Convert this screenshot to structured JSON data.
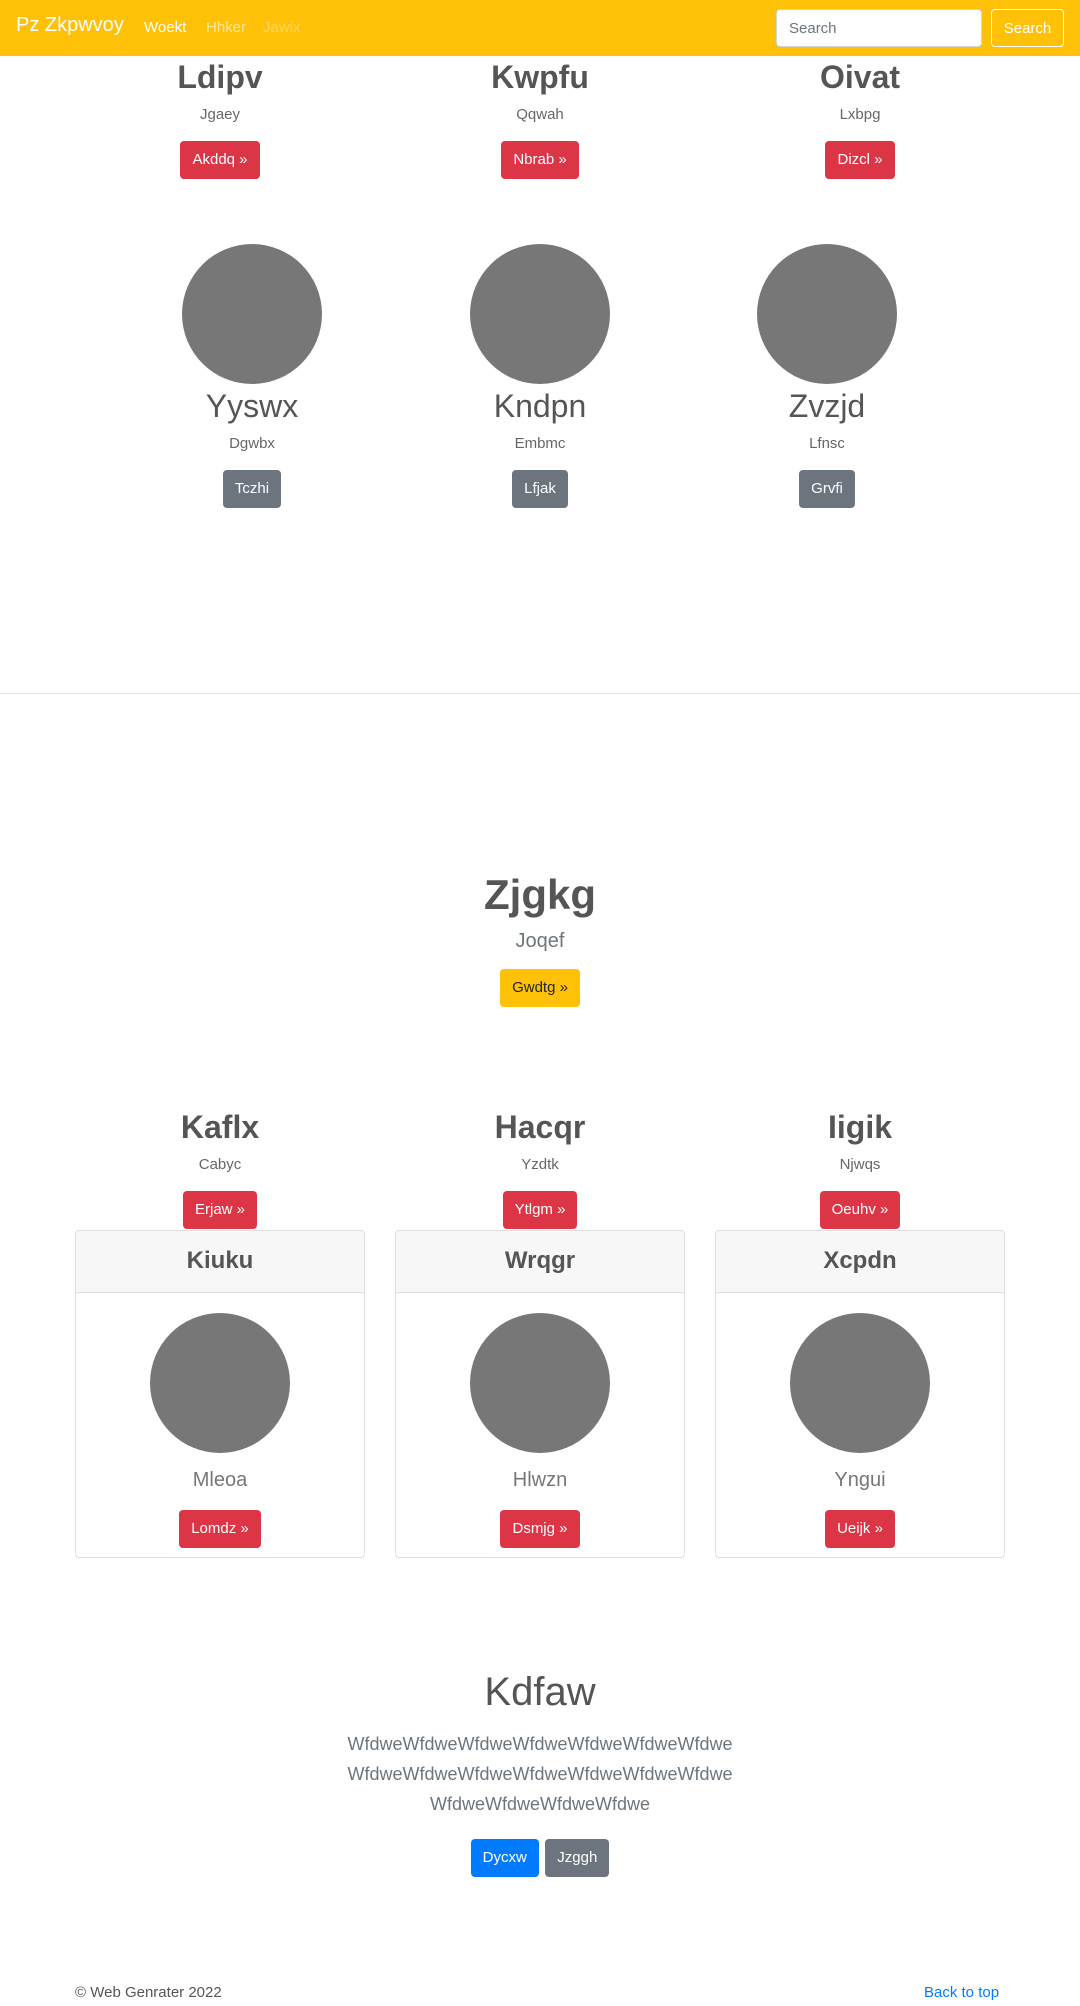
{
  "navbar": {
    "brand": "Pz Zkpwvoy",
    "links": [
      "Woekt",
      "Hhker",
      "Jawix"
    ],
    "search_placeholder": "Search",
    "search_button": "Search"
  },
  "row1": [
    {
      "title": "Ldipv",
      "sub": "Jgaey",
      "button": "Akddq »"
    },
    {
      "title": "Kwpfu",
      "sub": "Qqwah",
      "button": "Nbrab »"
    },
    {
      "title": "Oivat",
      "sub": "Lxbpg",
      "button": "Dizcl »"
    }
  ],
  "row2": [
    {
      "title": "Yyswx",
      "sub": "Dgwbx",
      "button": "Tczhi"
    },
    {
      "title": "Kndpn",
      "sub": "Embmc",
      "button": "Lfjak"
    },
    {
      "title": "Zvzjd",
      "sub": "Lfnsc",
      "button": "Grvfi"
    }
  ],
  "hero": {
    "title": "Zjgkg",
    "lead": "Joqef",
    "button": "Gwdtg »"
  },
  "row3": [
    {
      "title": "Kaflx",
      "sub": "Cabyc",
      "button": "Erjaw »"
    },
    {
      "title": "Hacqr",
      "sub": "Yzdtk",
      "button": "Ytlgm »"
    },
    {
      "title": "Iigik",
      "sub": "Njwqs",
      "button": "Oeuhv »"
    }
  ],
  "cards": [
    {
      "header": "Kiuku",
      "text": "Mleoa",
      "button": "Lomdz »"
    },
    {
      "header": "Wrqgr",
      "text": "Hlwzn",
      "button": "Dsmjg »"
    },
    {
      "header": "Xcpdn",
      "text": "Yngui",
      "button": "Ueijk »"
    }
  ],
  "jumbo": {
    "title": "Kdfaw",
    "paragraph": "WfdweWfdweWfdweWfdweWfdweWfdweWfdweWfdweWfdweWfdweWfdweWfdweWfdweWfdweWfdweWfdweWfdweWfdwe",
    "primary_button": "Dycxw",
    "secondary_button": "Jzggh"
  },
  "footer": {
    "copyright": "© Web Genrater 2022",
    "back_to_top": "Back to top"
  },
  "colors": {
    "navbar": "#ffc107",
    "danger": "#dc3545",
    "secondary": "#6c757d",
    "primary": "#007bff",
    "placeholder_circle": "#777777"
  }
}
